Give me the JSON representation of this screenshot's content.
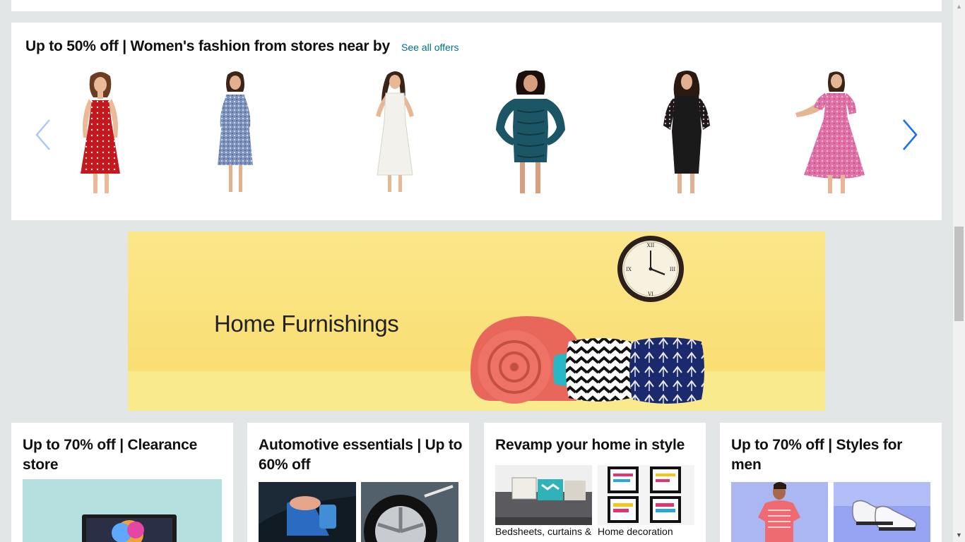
{
  "carousel": {
    "title": "Up to 50% off | Women's fashion from stores near by",
    "see_all": "See all offers",
    "products": [
      {
        "dress_color": "#c8161d",
        "pattern": "polka-dots"
      },
      {
        "dress_color": "#7f95bd",
        "pattern": "floral"
      },
      {
        "dress_color": "#f3f1ec",
        "pattern": "plain"
      },
      {
        "dress_color": "#1b5566",
        "pattern": "ruched"
      },
      {
        "dress_color": "#1a1a1a",
        "pattern": "floral-sleeves"
      },
      {
        "dress_color": "#df71a7",
        "pattern": "floral"
      }
    ]
  },
  "banner": {
    "title": "Home Furnishings"
  },
  "tiles": [
    {
      "title": "Up to 70% off | Clearance store"
    },
    {
      "title": "Automotive essentials | Up to 60% off"
    },
    {
      "title": "Revamp your home in style",
      "items": [
        "Bedsheets, curtains & more",
        "Home decoration"
      ]
    },
    {
      "title": "Up to 70% off | Styles for men"
    }
  ],
  "colors": {
    "page_bg": "#e3e6e6",
    "link": "#007185",
    "arrow": "#1a73e8",
    "banner_bg": "#fbe68a"
  }
}
